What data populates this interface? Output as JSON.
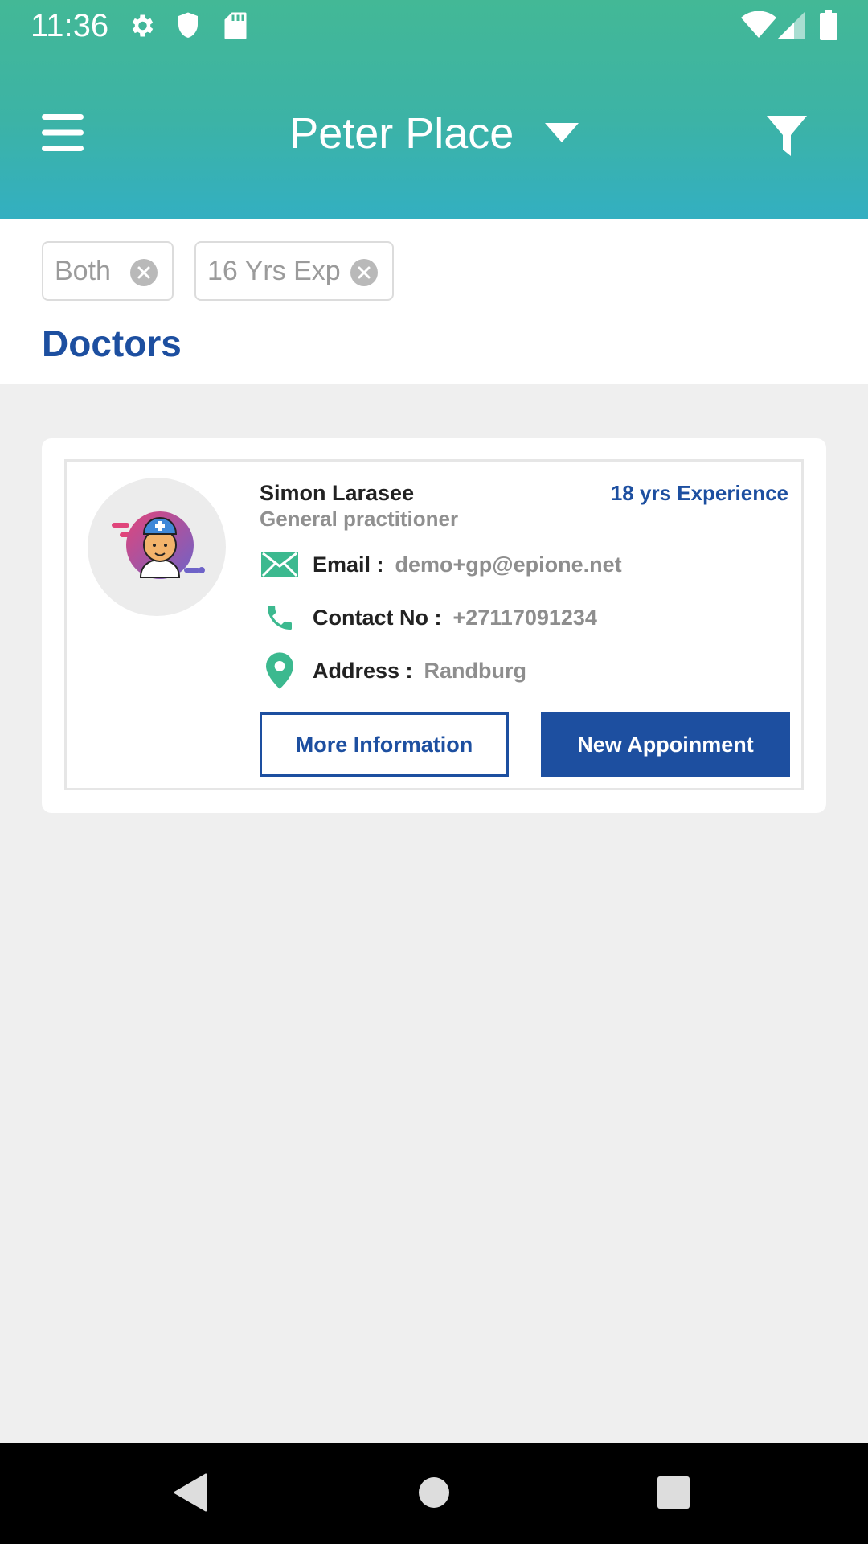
{
  "status_bar": {
    "time": "11:36",
    "left_icons": [
      "gear-icon",
      "shield-icon",
      "sd-card-icon"
    ],
    "right_icons": [
      "wifi-icon",
      "signal-icon",
      "battery-icon"
    ]
  },
  "app_bar": {
    "title": "Peter Place",
    "menu_icon": "menu-icon",
    "dropdown_icon": "caret-down-icon",
    "filter_icon": "filter-icon"
  },
  "filters": {
    "chips": [
      {
        "label": "Both"
      },
      {
        "label": "16 Yrs Exp"
      }
    ]
  },
  "section": {
    "title": "Doctors"
  },
  "doctor": {
    "name": "Simon Larasee",
    "specialty": "General practitioner",
    "experience": "18 yrs Experience",
    "email_label": "Email :",
    "email_value": "demo+gp@epione.net",
    "contact_label": "Contact No :",
    "contact_value": "+27117091234",
    "address_label": "Address :",
    "address_value": "Randburg",
    "more_info_label": "More Information",
    "new_appointment_label": "New Appoinment"
  },
  "colors": {
    "header_top": "#43b896",
    "header_bottom": "#33afc1",
    "brand_blue": "#1d4fa0",
    "icon_green": "#3cb98f"
  },
  "nav_bar": {
    "icons": [
      "back-icon",
      "home-icon",
      "recents-icon"
    ]
  }
}
